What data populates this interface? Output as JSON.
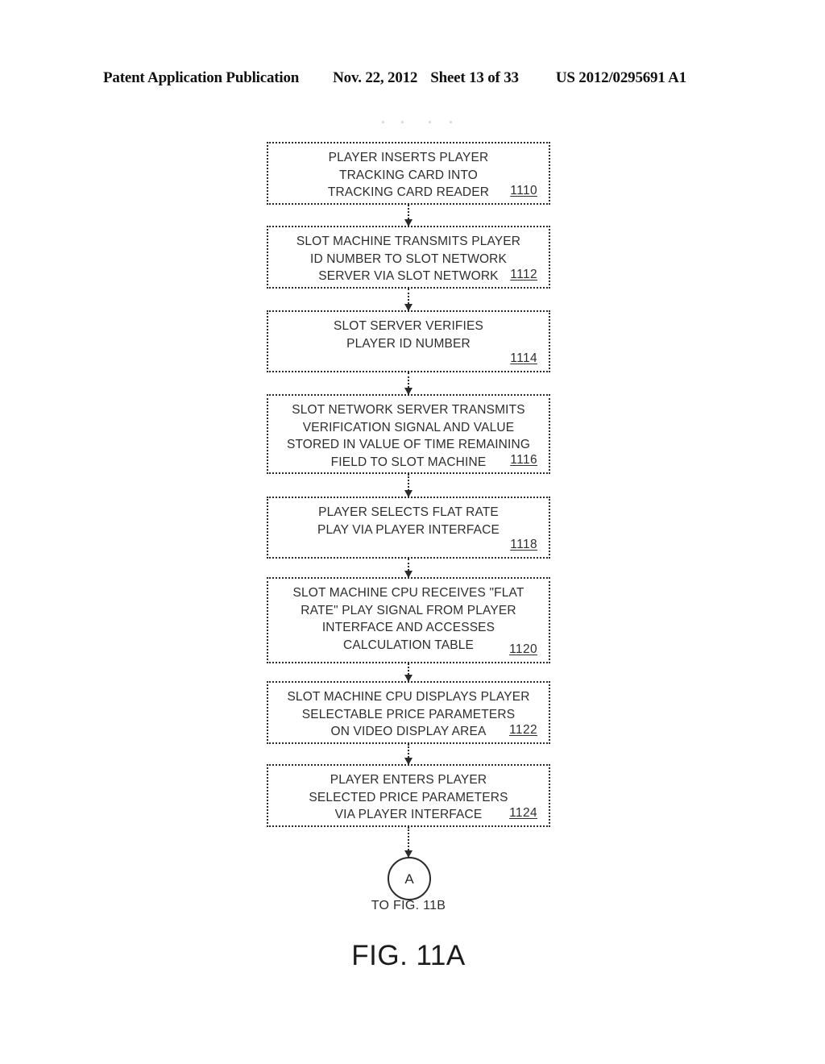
{
  "header": {
    "publication": "Patent Application Publication",
    "date": "Nov. 22, 2012",
    "sheet": "Sheet 13 of 33",
    "publication_number": "US 2012/0295691 A1"
  },
  "figure": {
    "caption": "FIG. 11A",
    "connector": {
      "label": "A",
      "caption": "TO FIG. 11B"
    },
    "boxes": [
      {
        "ref": "1110",
        "line1": "PLAYER INSERTS PLAYER",
        "line2": "TRACKING CARD INTO",
        "line3": "TRACKING CARD READER",
        "line4": "",
        "text": "PLAYER INSERTS PLAYER TRACKING CARD INTO TRACKING CARD READER"
      },
      {
        "ref": "1112",
        "line1": "SLOT MACHINE TRANSMITS PLAYER",
        "line2": "ID NUMBER TO SLOT NETWORK",
        "line3": "SERVER VIA SLOT NETWORK",
        "line4": "",
        "text": "SLOT MACHINE TRANSMITS PLAYER ID NUMBER TO SLOT NETWORK SERVER VIA SLOT NETWORK"
      },
      {
        "ref": "1114",
        "line1": "SLOT SERVER VERIFIES",
        "line2": "PLAYER ID NUMBER",
        "line3": "",
        "line4": "",
        "text": "SLOT SERVER VERIFIES PLAYER ID NUMBER"
      },
      {
        "ref": "1116",
        "line1": "SLOT NETWORK SERVER TRANSMITS",
        "line2": "VERIFICATION SIGNAL AND VALUE",
        "line3": "STORED IN VALUE OF TIME REMAINING",
        "line4": "FIELD TO SLOT MACHINE",
        "text": "SLOT NETWORK SERVER TRANSMITS VERIFICATION SIGNAL AND VALUE STORED IN VALUE OF TIME REMAINING FIELD TO SLOT MACHINE"
      },
      {
        "ref": "1118",
        "line1": "PLAYER SELECTS FLAT RATE",
        "line2": "PLAY VIA PLAYER INTERFACE",
        "line3": "",
        "line4": "",
        "text": "PLAYER SELECTS FLAT RATE PLAY VIA PLAYER INTERFACE"
      },
      {
        "ref": "1120",
        "line1": "SLOT MACHINE CPU RECEIVES \"FLAT",
        "line2": "RATE\" PLAY SIGNAL FROM PLAYER",
        "line3": "INTERFACE AND ACCESSES",
        "line4": "CALCULATION TABLE",
        "text": "SLOT MACHINE CPU RECEIVES \"FLAT RATE\" PLAY SIGNAL FROM PLAYER INTERFACE AND ACCESSES CALCULATION TABLE"
      },
      {
        "ref": "1122",
        "line1": "SLOT MACHINE CPU DISPLAYS PLAYER",
        "line2": "SELECTABLE PRICE PARAMETERS",
        "line3": "ON VIDEO DISPLAY AREA",
        "line4": "",
        "text": "SLOT MACHINE CPU DISPLAYS PLAYER SELECTABLE PRICE PARAMETERS ON VIDEO DISPLAY AREA"
      },
      {
        "ref": "1124",
        "line1": "PLAYER ENTERS PLAYER",
        "line2": "SELECTED PRICE PARAMETERS",
        "line3": "VIA PLAYER INTERFACE",
        "line4": "",
        "text": "PLAYER ENTERS PLAYER SELECTED PRICE PARAMETERS VIA PLAYER INTERFACE"
      }
    ]
  }
}
